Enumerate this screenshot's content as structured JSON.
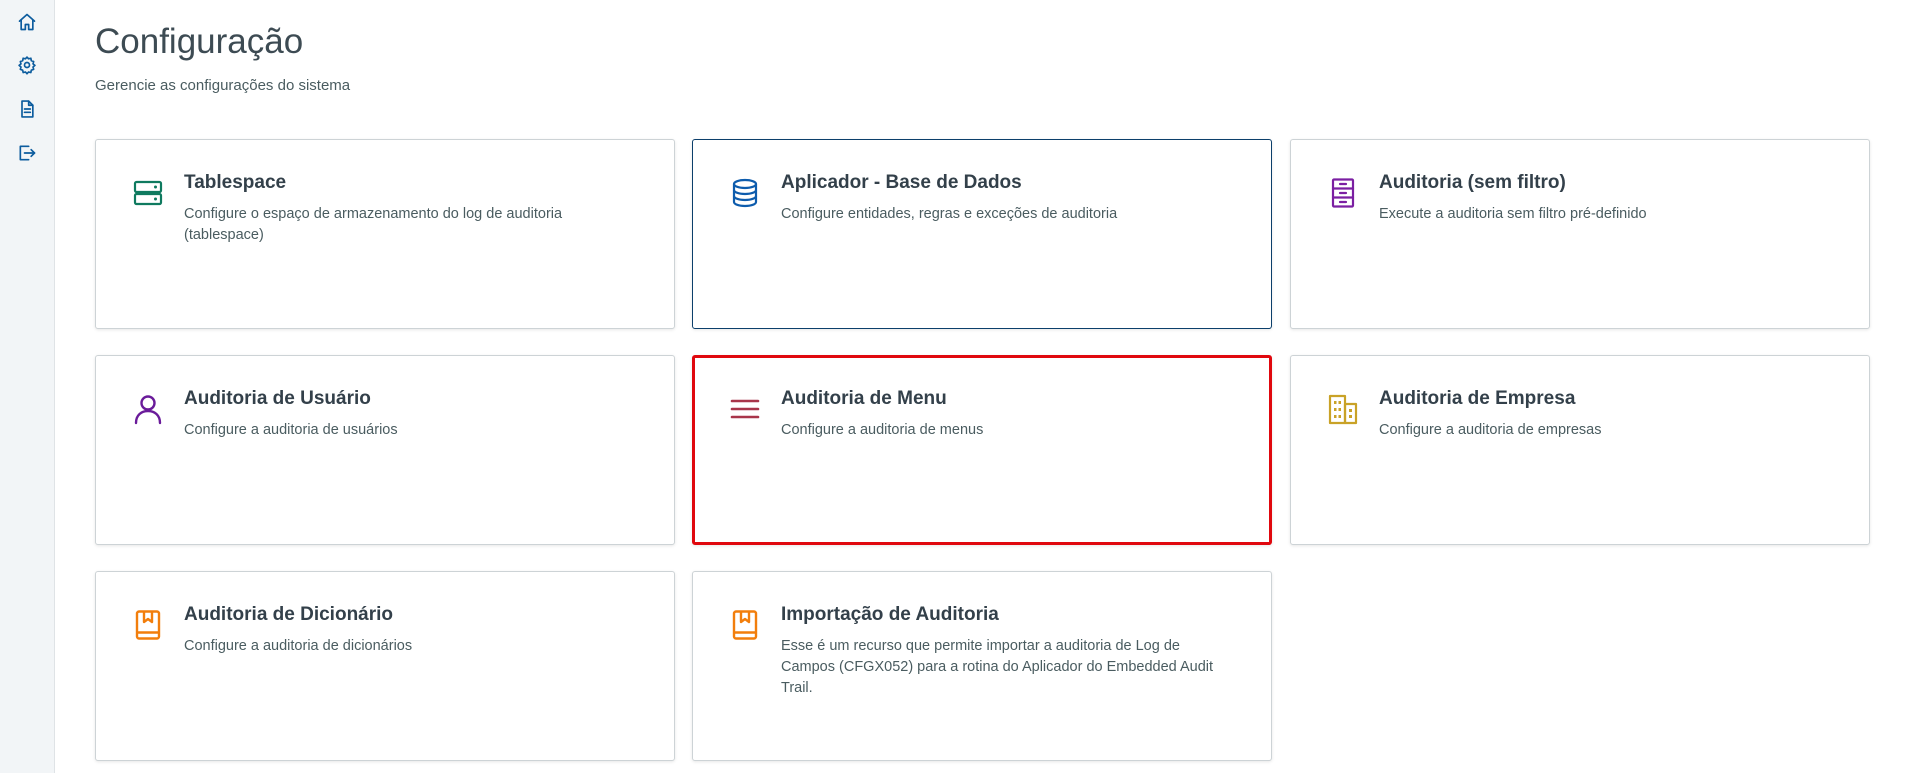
{
  "header": {
    "title": "Configuração",
    "subtitle": "Gerencie as configurações do sistema"
  },
  "sidebar": {
    "items": [
      {
        "icon": "home-icon"
      },
      {
        "icon": "gear-icon"
      },
      {
        "icon": "document-icon"
      },
      {
        "icon": "logout-icon"
      }
    ]
  },
  "cards": [
    {
      "title": "Tablespace",
      "description": "Configure o espaço de armazenamento do log de auditoria (tablespace)",
      "icon": "server-storage-icon",
      "icon_color": "#0f7a5f"
    },
    {
      "title": "Aplicador - Base de Dados",
      "description": "Configure entidades, regras e exceções de auditoria",
      "icon": "database-icon",
      "icon_color": "#0d5cad"
    },
    {
      "title": "Auditoria (sem filtro)",
      "description": "Execute a auditoria sem filtro pré-definido",
      "icon": "filing-cabinet-icon",
      "icon_color": "#7b1fa2"
    },
    {
      "title": "Auditoria de Usuário",
      "description": "Configure a auditoria de usuários",
      "icon": "user-icon",
      "icon_color": "#6a1b9a"
    },
    {
      "title": "Auditoria de Menu",
      "description": "Configure a auditoria de menus",
      "icon": "menu-lines-icon",
      "icon_color": "#a8354a"
    },
    {
      "title": "Auditoria de Empresa",
      "description": "Configure a auditoria de empresas",
      "icon": "building-icon",
      "icon_color": "#c9a227"
    },
    {
      "title": "Auditoria de Dicionário",
      "description": "Configure a auditoria de dicionários",
      "icon": "bookmark-book-icon",
      "icon_color": "#f27e0c"
    },
    {
      "title": "Importação de Auditoria",
      "description": "Esse é um recurso que permite importar a auditoria de Log de Campos (CFGX052) para a rotina do Aplicador do Embedded Audit Trail.",
      "icon": "bookmark-book-icon",
      "icon_color": "#f27e0c"
    }
  ],
  "colors": {
    "active_border": "#0c3f6b",
    "highlight_border": "#e0080e",
    "sidebar_icon": "#0c5c9e"
  }
}
